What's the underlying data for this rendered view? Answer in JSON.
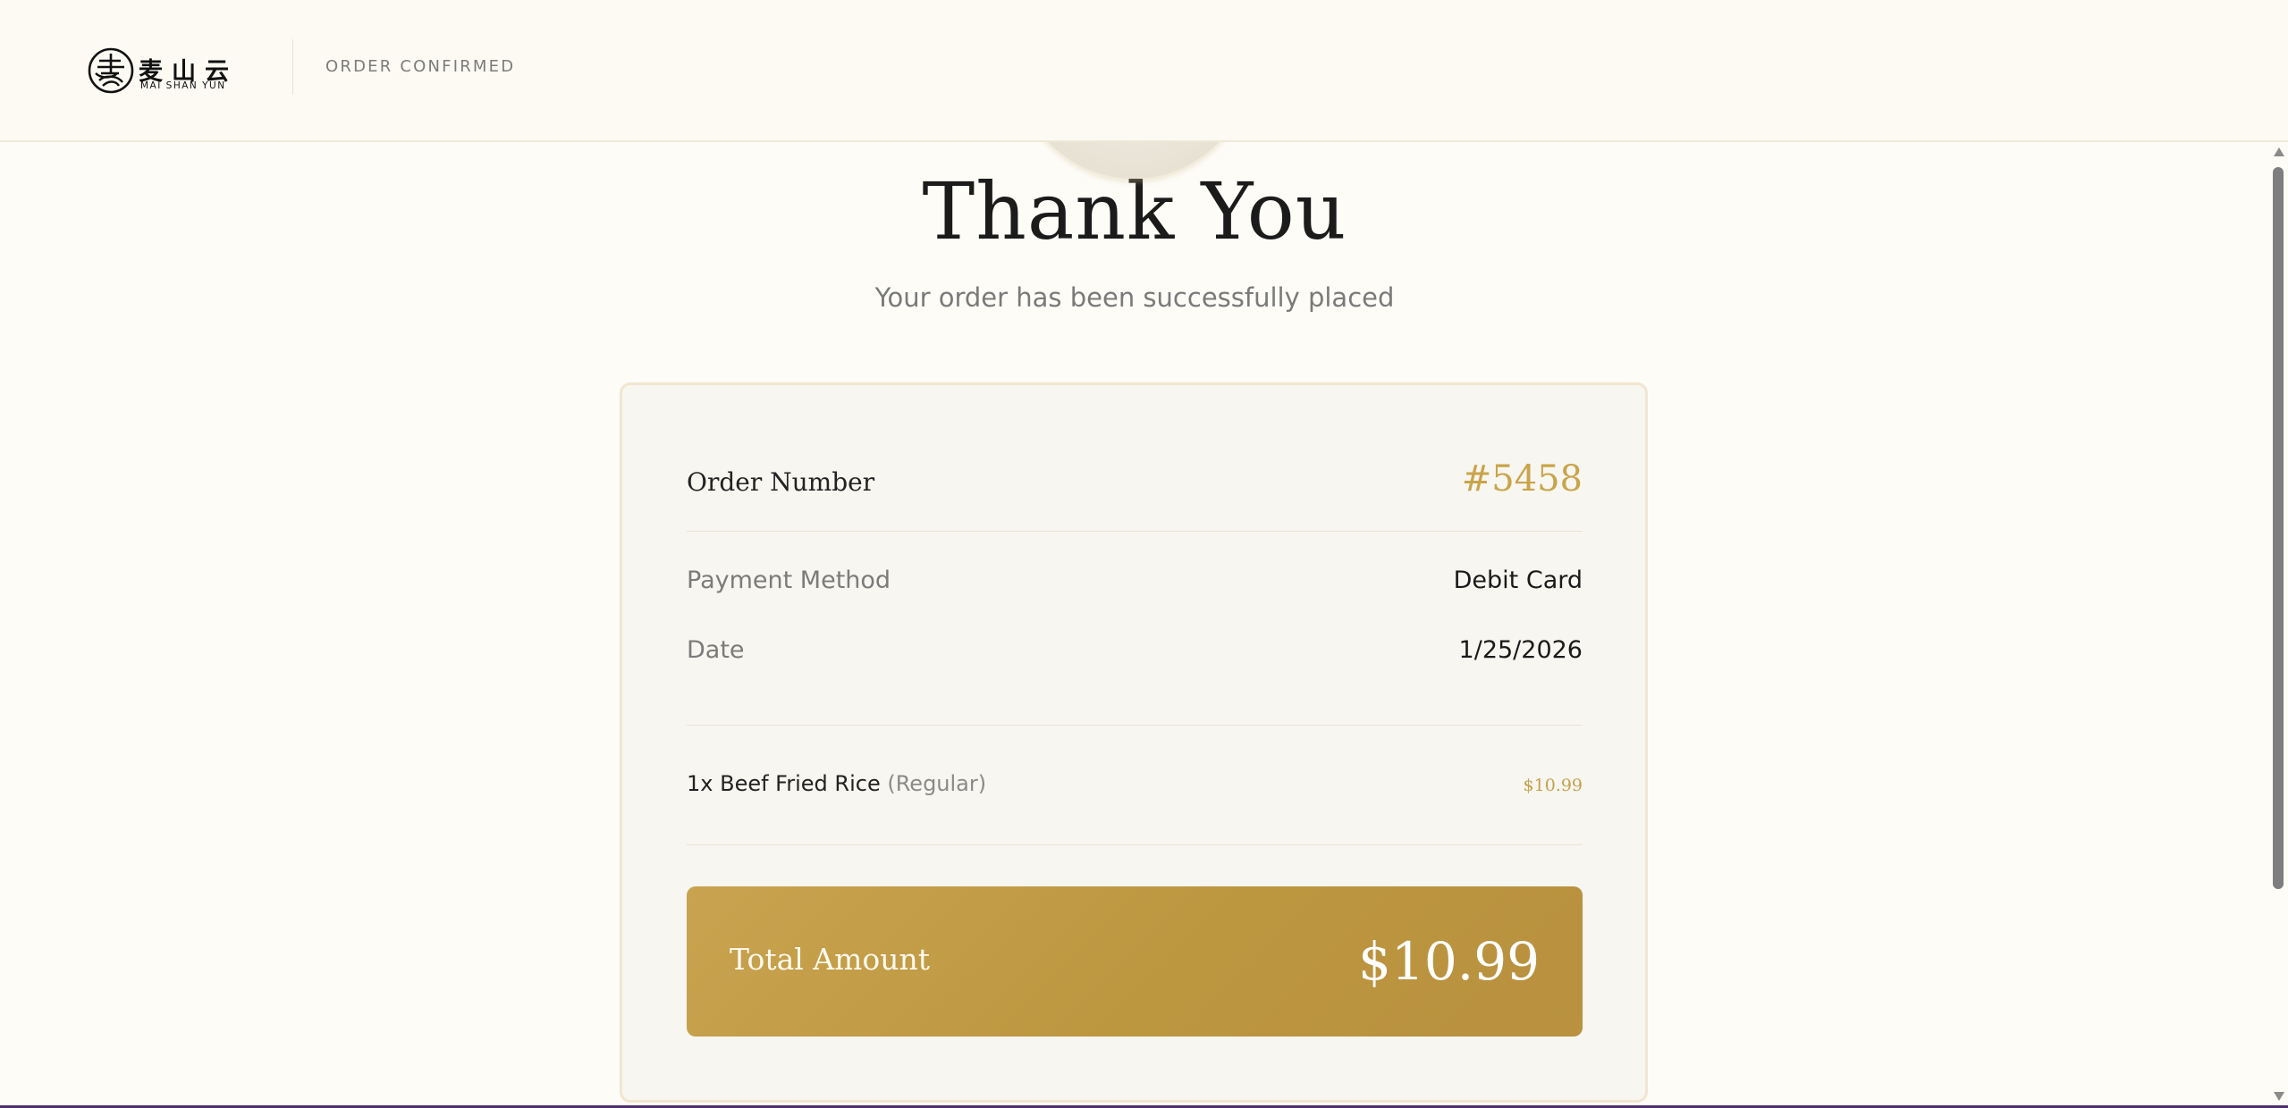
{
  "header": {
    "logo_cn": "麦山云",
    "logo_en": "MAI SHAN YUN",
    "status": "ORDER CONFIRMED"
  },
  "confirmation": {
    "title": "Thank You",
    "subtitle": "Your order has been successfully placed"
  },
  "order": {
    "number_label": "Order Number",
    "number": "#5458",
    "payment_label": "Payment Method",
    "payment_value": "Debit Card",
    "date_label": "Date",
    "date_value": "1/25/2026",
    "items": [
      {
        "quantity_name": "1x Beef Fried Rice",
        "variant": "(Regular)",
        "price": "$10.99"
      }
    ],
    "total_label": "Total Amount",
    "total_value": "$10.99"
  },
  "colors": {
    "accent_gold": "#c9a44a",
    "background": "#fdfcf7",
    "card_background": "#f8f6f0"
  },
  "icons": [
    "brand-logo-icon",
    "scroll-up-arrow-icon",
    "scroll-down-arrow-icon"
  ]
}
